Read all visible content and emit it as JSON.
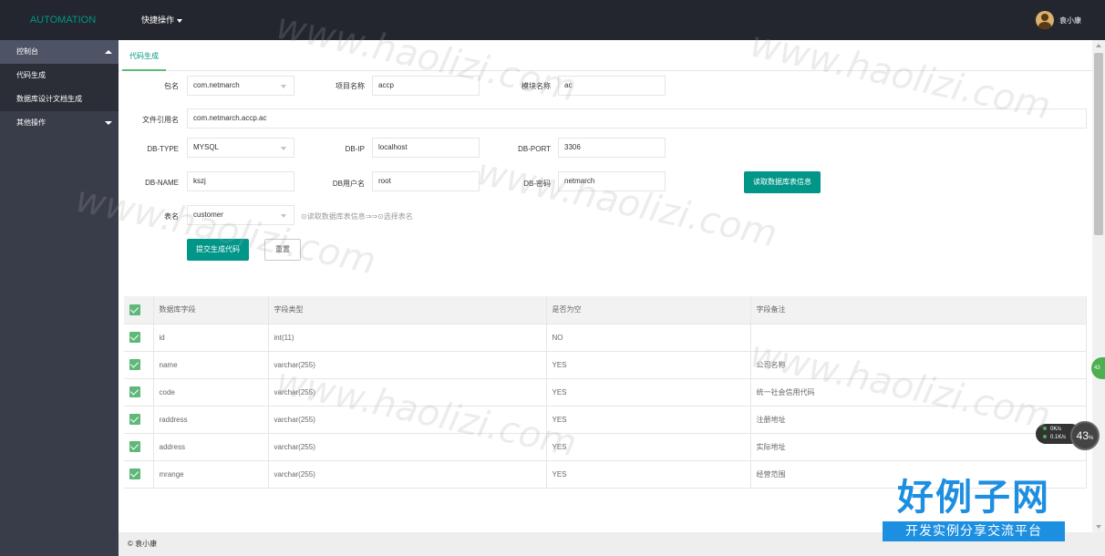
{
  "header": {
    "app_title": "AUTOMATION",
    "quick_menu_label": "快捷操作",
    "user_name": "袁小康"
  },
  "sidebar": {
    "sections": [
      {
        "label": "控制台",
        "expanded": true,
        "items": [
          {
            "label": "代码生成"
          },
          {
            "label": "数据库设计文档生成"
          }
        ]
      },
      {
        "label": "其他操作",
        "expanded": false,
        "items": []
      }
    ]
  },
  "tabs": [
    {
      "label": "代码生成",
      "active": true
    }
  ],
  "form": {
    "package_label": "包名",
    "package_value": "com.netmarch",
    "project_label": "项目名称",
    "project_value": "accp",
    "module_label": "模块名称",
    "module_value": "ac",
    "import_label": "文件引用名",
    "import_value": "com.netmarch.accp.ac",
    "dbtype_label": "DB-TYPE",
    "dbtype_value": "MYSQL",
    "dbip_label": "DB-IP",
    "dbip_value": "localhost",
    "dbport_label": "DB-PORT",
    "dbport_value": "3306",
    "dbname_label": "DB-NAME",
    "dbname_value": "kszj",
    "dbuser_label": "DB用户名",
    "dbuser_value": "root",
    "dbpass_label": "DB-密码",
    "dbpass_value": "netmarch",
    "read_db_button": "读取数据库表信息",
    "table_label": "表名",
    "table_value": "customer",
    "table_hint": "⊙读取数据库表信息⇒⇒⊙选择表名",
    "submit_button": "提交生成代码",
    "reset_button": "重置"
  },
  "table": {
    "columns": [
      "数据库字段",
      "字段类型",
      "是否为空",
      "字段备注"
    ],
    "rows": [
      {
        "field": "id",
        "type": "int(11)",
        "nullable": "NO",
        "comment": ""
      },
      {
        "field": "name",
        "type": "varchar(255)",
        "nullable": "YES",
        "comment": "公司名称"
      },
      {
        "field": "code",
        "type": "varchar(255)",
        "nullable": "YES",
        "comment": "统一社会信用代码"
      },
      {
        "field": "raddress",
        "type": "varchar(255)",
        "nullable": "YES",
        "comment": "注册地址"
      },
      {
        "field": "address",
        "type": "varchar(255)",
        "nullable": "YES",
        "comment": "实际地址"
      },
      {
        "field": "mrange",
        "type": "varchar(255)",
        "nullable": "YES",
        "comment": "经营范围"
      }
    ]
  },
  "footer": {
    "text": "© 袁小康"
  },
  "overlays": {
    "net_up": "0K/s",
    "net_down": "0.1K/s",
    "percent": "43",
    "percent_unit": "%",
    "edge_badge": "43",
    "watermark": "www.haolizi.com",
    "brand_title": "好例子网",
    "brand_subtitle": "开发实例分享交流平台"
  },
  "colors": {
    "accent": "#009688",
    "topbar": "#23262e",
    "sidebar": "#393d49",
    "check": "#5fb878"
  }
}
